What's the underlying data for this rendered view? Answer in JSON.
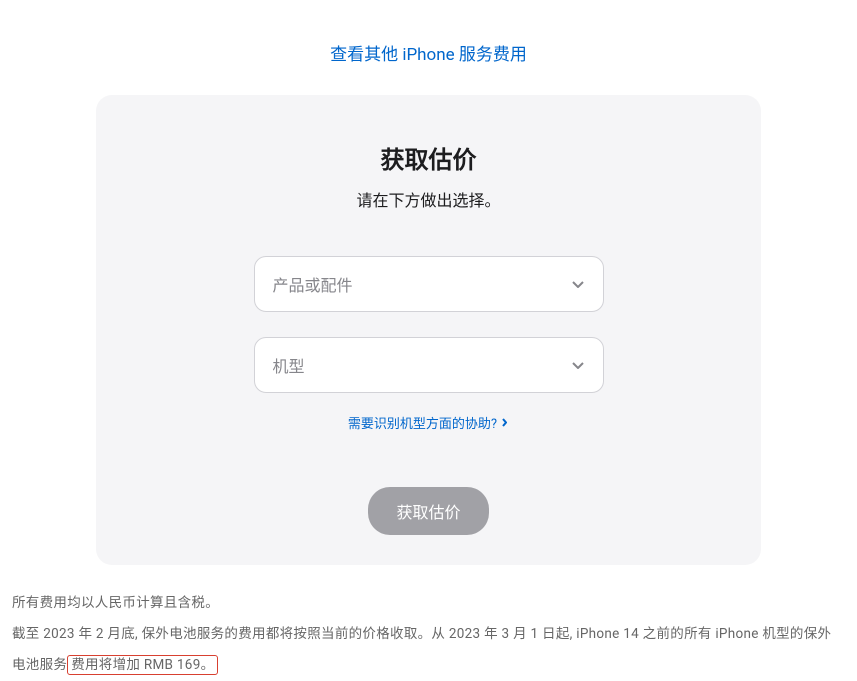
{
  "topLink": {
    "label": "查看其他 iPhone 服务费用"
  },
  "card": {
    "title": "获取估价",
    "subtitle": "请在下方做出选择。",
    "select1": {
      "placeholder": "产品或配件"
    },
    "select2": {
      "placeholder": "机型"
    },
    "helpLink": {
      "label": "需要识别机型方面的协助?"
    },
    "button": {
      "label": "获取估价"
    }
  },
  "footer": {
    "line1": "所有费用均以人民币计算且含税。",
    "line2_part1": "截至 2023 年 2 月底, 保外电池服务的费用都将按照当前的价格收取。从 2023 年 3 月 1 日起, iPhone 14 之前的所有 iPhone 机型的保外电池服务",
    "line2_highlight": "费用将增加 RMB 169。"
  }
}
